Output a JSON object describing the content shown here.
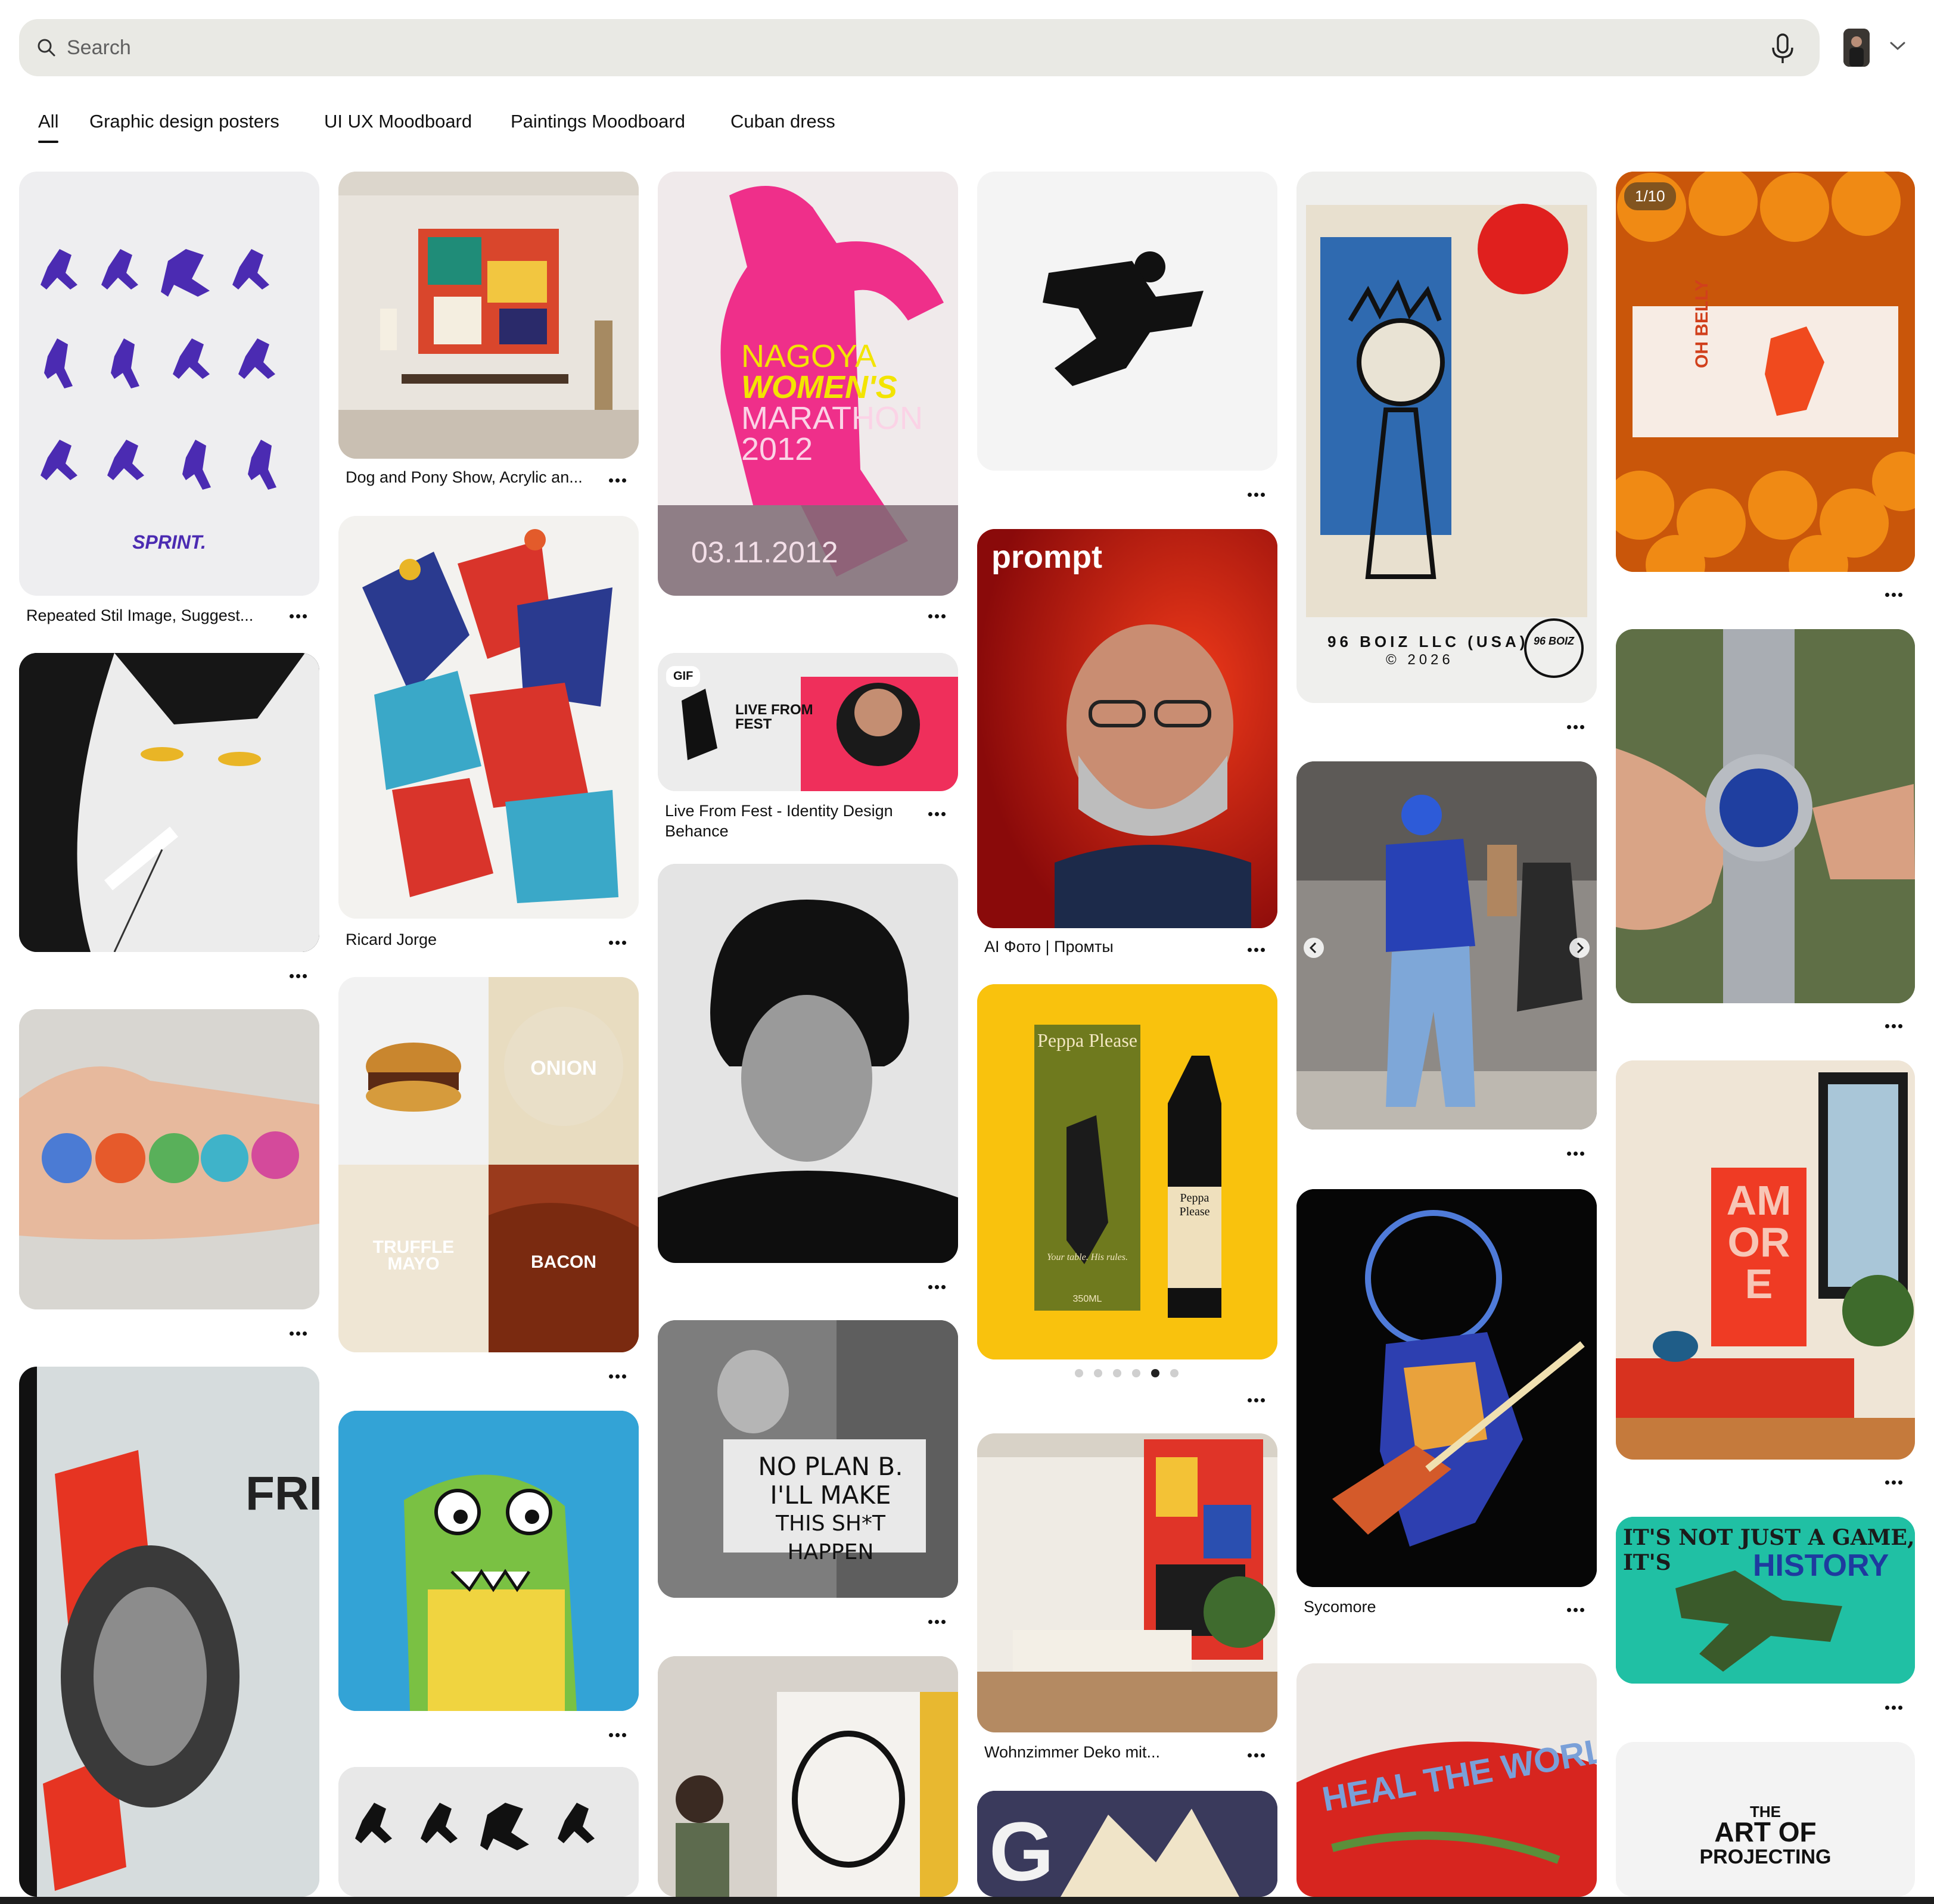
{
  "search": {
    "placeholder": "Search"
  },
  "tabs": [
    "All",
    "Graphic design posters",
    "UI UX Moodboard",
    "Paintings Moodboard",
    "Cuban dress"
  ],
  "active_tab": "All",
  "pins": {
    "c1_1": {
      "title": "Repeated Stil Image, Suggest...",
      "overlay": "SPRINT."
    },
    "c2_1": {
      "title": "Dog and Pony Show, Acrylic an..."
    },
    "c2_2": {
      "title": "Ricard Jorge"
    },
    "c2_3": {
      "onion": "ONION",
      "truffle": "TRUFFLE",
      "mayo": "MAYO",
      "bacon": "BACON"
    },
    "c3_1": {
      "line1": "NAGOYA",
      "line2": "WOMEN'S",
      "line3": "MARATHON",
      "line4": "2012",
      "date": "03.11.2012"
    },
    "c3_2": {
      "title1": "Live From Fest - Identity Design",
      "title2": "Behance",
      "badge": "GIF",
      "logo": "LIVE FROM FEST"
    },
    "c3_4": {
      "sign1": "NO PLAN B.",
      "sign2": "I'LL MAKE",
      "sign3": "THIS SH*T HAPPEN"
    },
    "c4_2": {
      "title": "AI Фото | Промты",
      "overlay": "prompt"
    },
    "c4_3": {
      "brand": "Peppa Please",
      "volume": "350ML",
      "tagline": "Your table. His rules."
    },
    "c4_4": {
      "title": "Wohnzimmer Deko mit..."
    },
    "c5_1": {
      "label1": "96 BOIZ LLC (USA)",
      "label2": "© 2026",
      "seal": "96 BOIZ"
    },
    "c5_3": {
      "title": "Sycomore"
    },
    "c5_4": {
      "hat": "HEAL THE WORLD"
    },
    "c6_1": {
      "badge": "1/10",
      "brand": "OH BELLY"
    },
    "c6_3": {
      "poster": "AMORE"
    },
    "c6_4": {
      "line1": "IT'S NOT JUST A GAME, IT'S",
      "line2": "HISTORY"
    },
    "c6_5": {
      "line1": "THE",
      "line2": "ART OF",
      "line3": "PROJECTING"
    }
  },
  "colors": {
    "accent": "#111111",
    "search_bg": "#e9e9e4"
  }
}
